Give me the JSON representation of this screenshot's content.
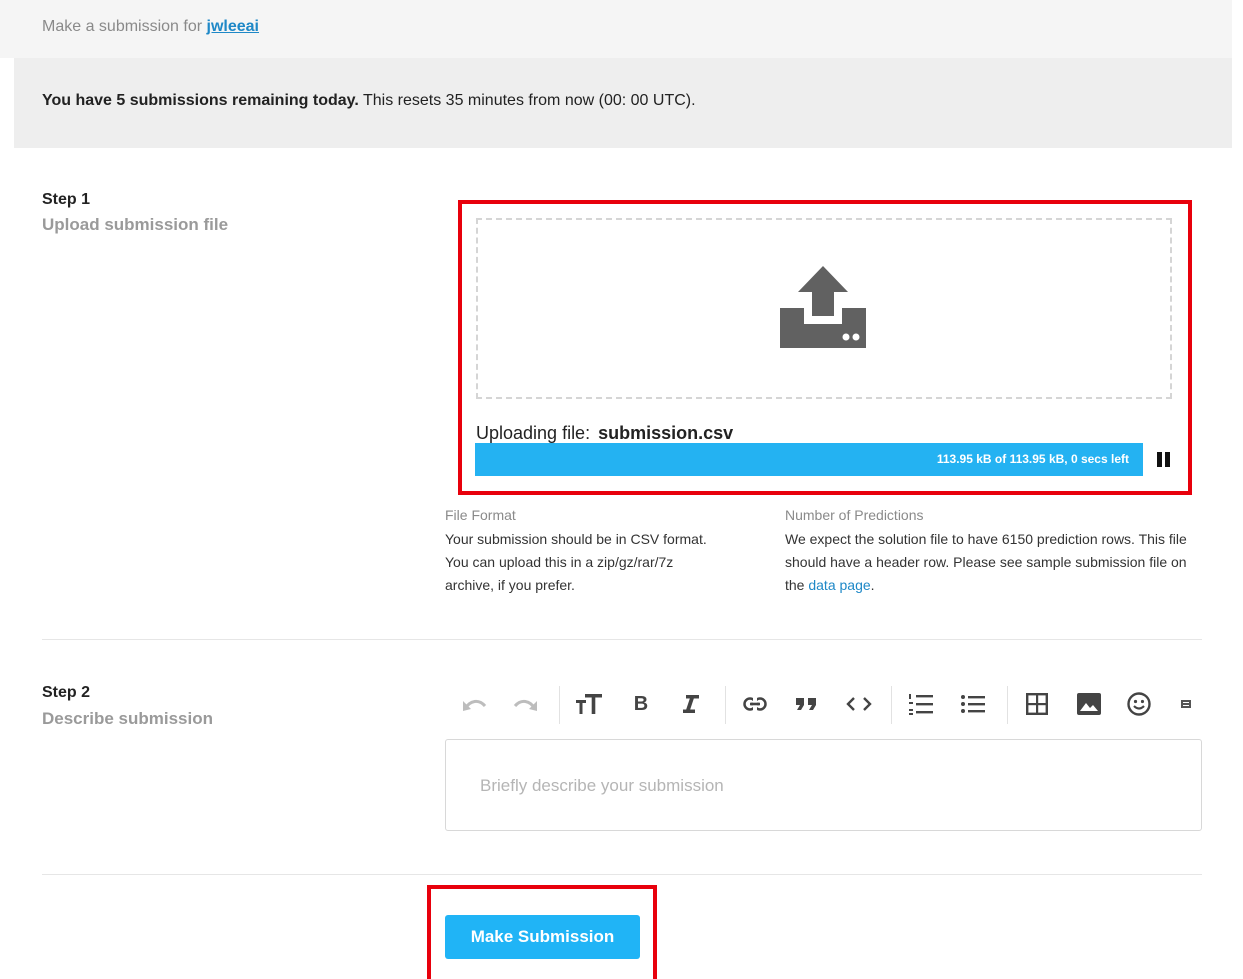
{
  "header": {
    "prefix": "Make a submission for",
    "user_link": "jwleeai"
  },
  "notice": {
    "bold": "You have 5 submissions remaining today.",
    "rest": "This resets 35 minutes from now (00: 00 UTC)."
  },
  "step1": {
    "title": "Step 1",
    "subtitle": "Upload submission file",
    "dropzone_icon": "upload-icon",
    "uploading_label": "Uploading file:",
    "file_name": "submission.csv",
    "progress_text": "113.95 kB of 113.95 kB, 0 secs left",
    "progress_fraction": 1.0,
    "pause_icon": "pause-icon"
  },
  "file_format": {
    "title": "File Format",
    "body": "Your submission should be in CSV format. You can upload this in a zip/gz/rar/7z archive, if you prefer."
  },
  "num_predictions": {
    "title": "Number of Predictions",
    "body_before": "We expect the solution file to have 6150 prediction rows. This file should have a header row. Please see sample submission file on the",
    "link": "data page",
    "body_after": "."
  },
  "step2": {
    "title": "Step 2",
    "subtitle": "Describe submission",
    "toolbar": [
      "undo-icon",
      "redo-icon",
      "text-size-icon",
      "bold-icon",
      "italic-icon",
      "link-icon",
      "quote-icon",
      "code-icon",
      "ordered-list-icon",
      "bullet-list-icon",
      "table-icon",
      "image-icon",
      "emoji-icon",
      "markdown-icon"
    ],
    "editor_placeholder": "Briefly describe your submission"
  },
  "submit": {
    "label": "Make Submission"
  },
  "colors": {
    "accent": "#20b4f6",
    "link": "#1e88c7",
    "highlight": "#e8000c"
  }
}
